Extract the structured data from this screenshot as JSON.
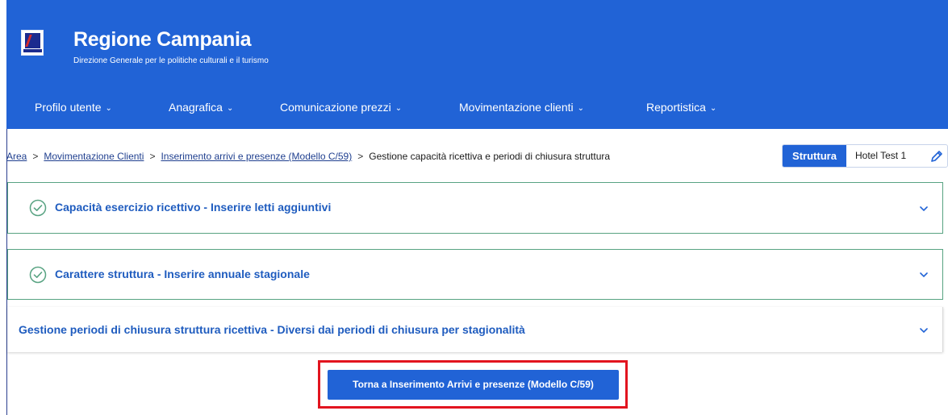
{
  "header": {
    "title": "Regione Campania",
    "subtitle": "Direzione Generale per le politiche culturali e il turismo"
  },
  "nav": {
    "items": [
      {
        "label": "Profilo utente"
      },
      {
        "label": "Anagrafica"
      },
      {
        "label": "Comunicazione prezzi"
      },
      {
        "label": "Movimentazione clienti"
      },
      {
        "label": "Reportistica"
      }
    ]
  },
  "breadcrumb": {
    "items": [
      {
        "label": "Area"
      },
      {
        "label": "Movimentazione Clienti"
      },
      {
        "label": "Inserimento arrivi e presenze (Modello C/59)"
      },
      {
        "label": "Gestione capacità ricettiva e periodi di chiusura struttura"
      }
    ],
    "separator": ">"
  },
  "struttura": {
    "label": "Struttura",
    "value": "Hotel Test 1"
  },
  "accordions": [
    {
      "title": "Capacità esercizio ricettivo - Inserire letti aggiuntivi",
      "completed": true
    },
    {
      "title": "Carattere struttura - Inserire annuale stagionale",
      "completed": true
    },
    {
      "title": "Gestione periodi di chiusura struttura ricettiva - Diversi dai periodi di chiusura per stagionalità",
      "completed": false
    }
  ],
  "back_button": {
    "label": "Torna a Inserimento Arrivi e presenze (Modello C/59)"
  },
  "colors": {
    "primary": "#2163d6",
    "accent_green": "#58a382",
    "highlight_red": "#e2141f",
    "link": "#1f5cbf"
  },
  "icons": {
    "logo": "regione-campania-logo",
    "nav_chevron": "chevron-down-icon",
    "edit": "pencil-icon",
    "completed": "check-circle-icon",
    "accordion_toggle": "chevron-down-icon"
  }
}
